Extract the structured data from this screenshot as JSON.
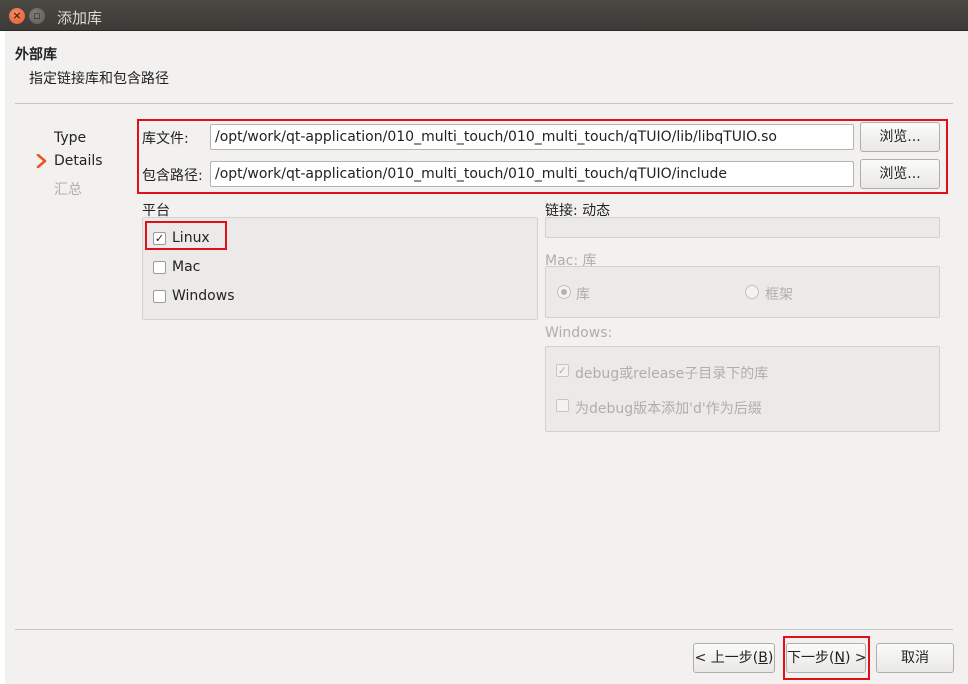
{
  "window": {
    "title": "添加库",
    "close_glyph": "×",
    "max_glyph": "▫"
  },
  "header": {
    "title": "外部库",
    "subtitle": "指定链接库和包含路径"
  },
  "nav": {
    "items": [
      {
        "label": "Type",
        "state": "done"
      },
      {
        "label": "Details",
        "state": "current"
      },
      {
        "label": "汇总",
        "state": "pending"
      }
    ]
  },
  "library_file": {
    "label": "库文件:",
    "value": "/opt/work/qt-application/010_multi_touch/010_multi_touch/qTUIO/lib/libqTUIO.so",
    "browse_label": "浏览..."
  },
  "include_path": {
    "label": "包含路径:",
    "value": "/opt/work/qt-application/010_multi_touch/010_multi_touch/qTUIO/include",
    "browse_label": "浏览..."
  },
  "platform": {
    "title": "平台",
    "options": [
      {
        "label": "Linux",
        "checked": true
      },
      {
        "label": "Mac",
        "checked": false
      },
      {
        "label": "Windows",
        "checked": false
      }
    ]
  },
  "linkage": {
    "title": "链接: 动态"
  },
  "mac": {
    "title": "Mac: 库",
    "options": [
      {
        "label": "库",
        "checked": true
      },
      {
        "label": "框架",
        "checked": false
      }
    ]
  },
  "windows": {
    "title": "Windows:",
    "options": [
      {
        "label": "debug或release子目录下的库",
        "checked": true
      },
      {
        "label": "为debug版本添加'd'作为后缀",
        "checked": false
      }
    ]
  },
  "footer": {
    "back": {
      "pre": "< 上一步(",
      "key": "B",
      "post": ")"
    },
    "next": {
      "pre": "下一步(",
      "key": "N",
      "post": ") >"
    },
    "cancel": "取消"
  },
  "colors": {
    "highlight": "#e0101b",
    "arrow": "#e95420",
    "titlebar": "#3c3b37"
  }
}
